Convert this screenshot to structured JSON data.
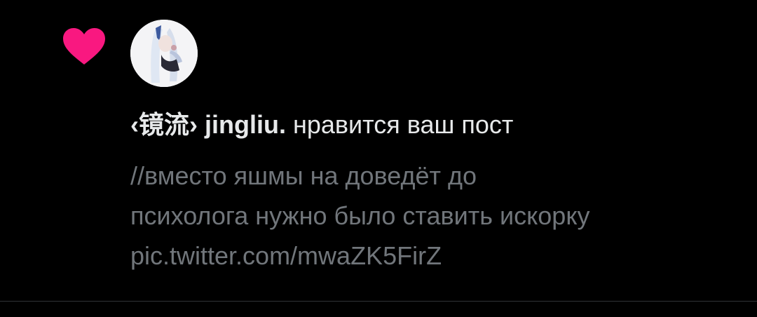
{
  "colors": {
    "background": "#000000",
    "heart": "#f91880",
    "primary_text": "#e7e9ea",
    "secondary_text": "#71767b",
    "divider": "#2f3336"
  },
  "icons": {
    "like": "heart-icon",
    "avatar": "user-avatar"
  },
  "notification": {
    "display_name": "‹镜流› jingliu.",
    "action": "нравится ваш пост",
    "post_lines": [
      "//вместо яшмы на доведёт до",
      "психолога нужно было ставить искорку",
      "pic.twitter.com/mwaZK5FirZ"
    ]
  }
}
